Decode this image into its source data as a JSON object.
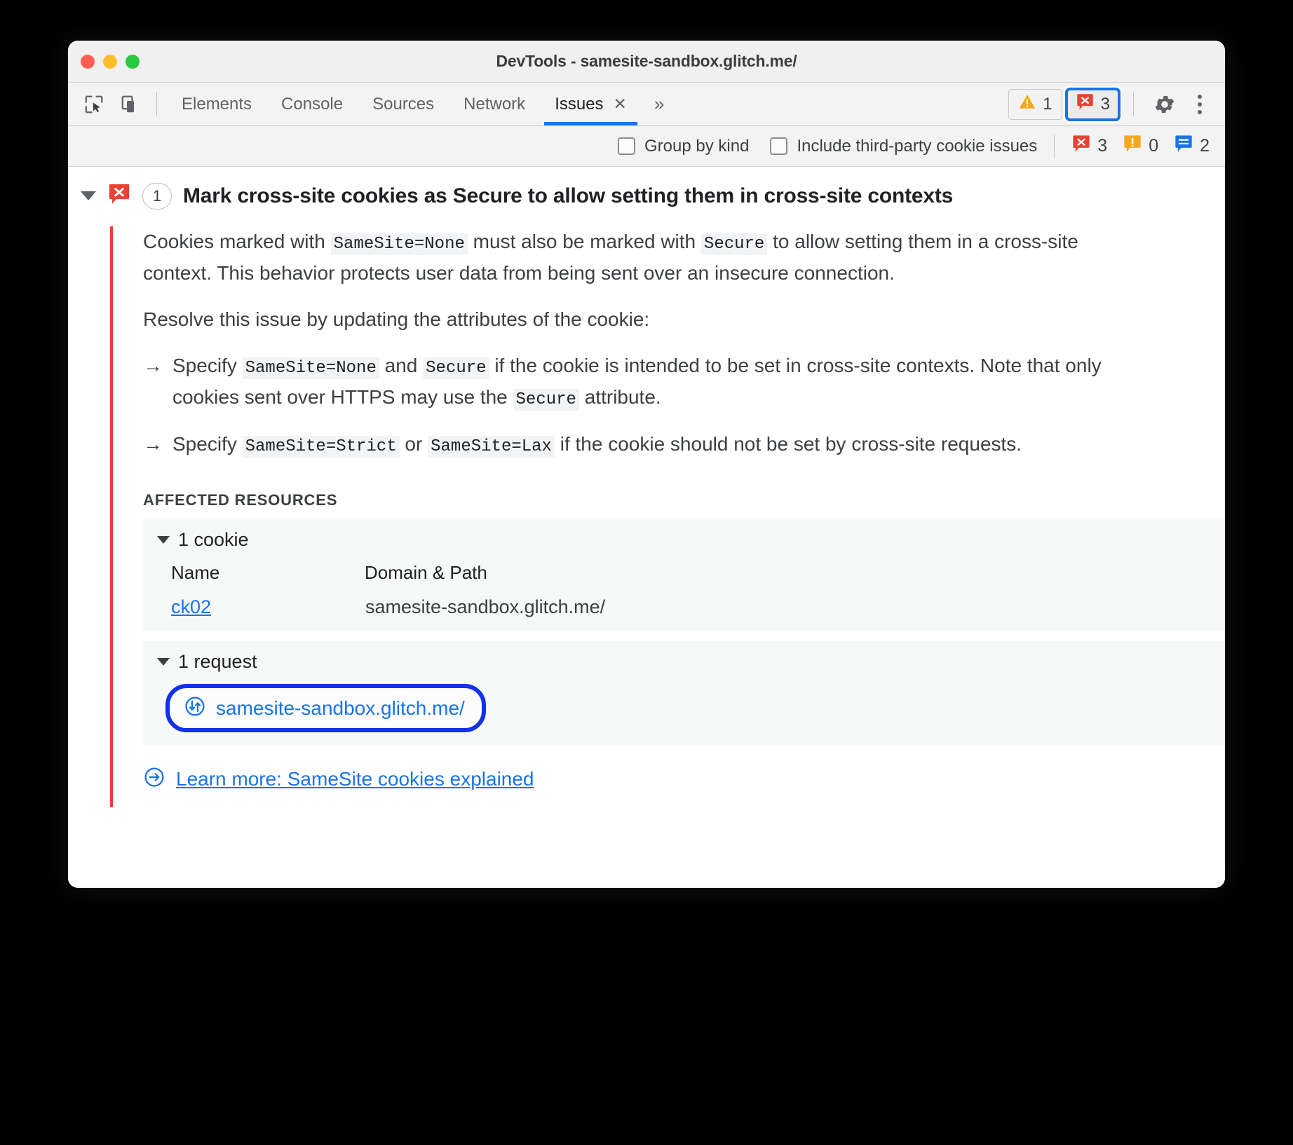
{
  "window": {
    "title": "DevTools - samesite-sandbox.glitch.me/"
  },
  "toolbar": {
    "inspect_icon": "inspect-cursor-icon",
    "device_icon": "device-toolbar-icon",
    "tabs": [
      {
        "label": "Elements",
        "active": false
      },
      {
        "label": "Console",
        "active": false
      },
      {
        "label": "Sources",
        "active": false
      },
      {
        "label": "Network",
        "active": false
      },
      {
        "label": "Issues",
        "active": true,
        "close": "✕"
      }
    ],
    "more_tabs": "»",
    "warning_count": "1",
    "error_count": "3",
    "settings_icon": "gear-icon",
    "menu_icon": "kebab-menu-icon"
  },
  "filterbar": {
    "group_by_kind": "Group by kind",
    "include_third_party": "Include third-party cookie issues",
    "counts": {
      "errors": "3",
      "warnings": "0",
      "info": "2"
    }
  },
  "issue": {
    "badge_icon": "error-icon",
    "occurrence_count": "1",
    "title": "Mark cross-site cookies as Secure to allow setting them in cross-site contexts",
    "paragraph1": {
      "t1": "Cookies marked with ",
      "c1": "SameSite=None",
      "t2": " must also be marked with ",
      "c2": "Secure",
      "t3": " to allow setting them in a cross-site context. This behavior protects user data from being sent over an insecure connection."
    },
    "paragraph2": "Resolve this issue by updating the attributes of the cookie:",
    "bullet1": {
      "arrow": "→",
      "t1": "Specify ",
      "c1": "SameSite=None",
      "t2": " and ",
      "c2": "Secure",
      "t3": " if the cookie is intended to be set in cross-site contexts. Note that only cookies sent over HTTPS may use the ",
      "c3": "Secure",
      "t4": " attribute."
    },
    "bullet2": {
      "arrow": "→",
      "t1": "Specify ",
      "c1": "SameSite=Strict",
      "t2": " or ",
      "c2": "SameSite=Lax",
      "t3": " if the cookie should not be set by cross-site requests."
    },
    "affected_resources_label": "AFFECTED RESOURCES",
    "cookie_section": {
      "header": "1 cookie",
      "columns": [
        "Name",
        "Domain & Path"
      ],
      "rows": [
        {
          "name": "ck02",
          "domain_path": "samesite-sandbox.glitch.me/"
        }
      ]
    },
    "request_section": {
      "header": "1 request",
      "icon": "request-arrows-icon",
      "url": "samesite-sandbox.glitch.me/"
    },
    "learn_more": {
      "icon": "arrow-circle-right-icon",
      "label": "Learn more: SameSite cookies explained"
    }
  },
  "colors": {
    "error_red": "#e94235",
    "warning_orange": "#f5a623",
    "info_blue": "#1a73e8",
    "accent_blue": "#1a73e8",
    "highlight_ring": "#1330ee"
  }
}
